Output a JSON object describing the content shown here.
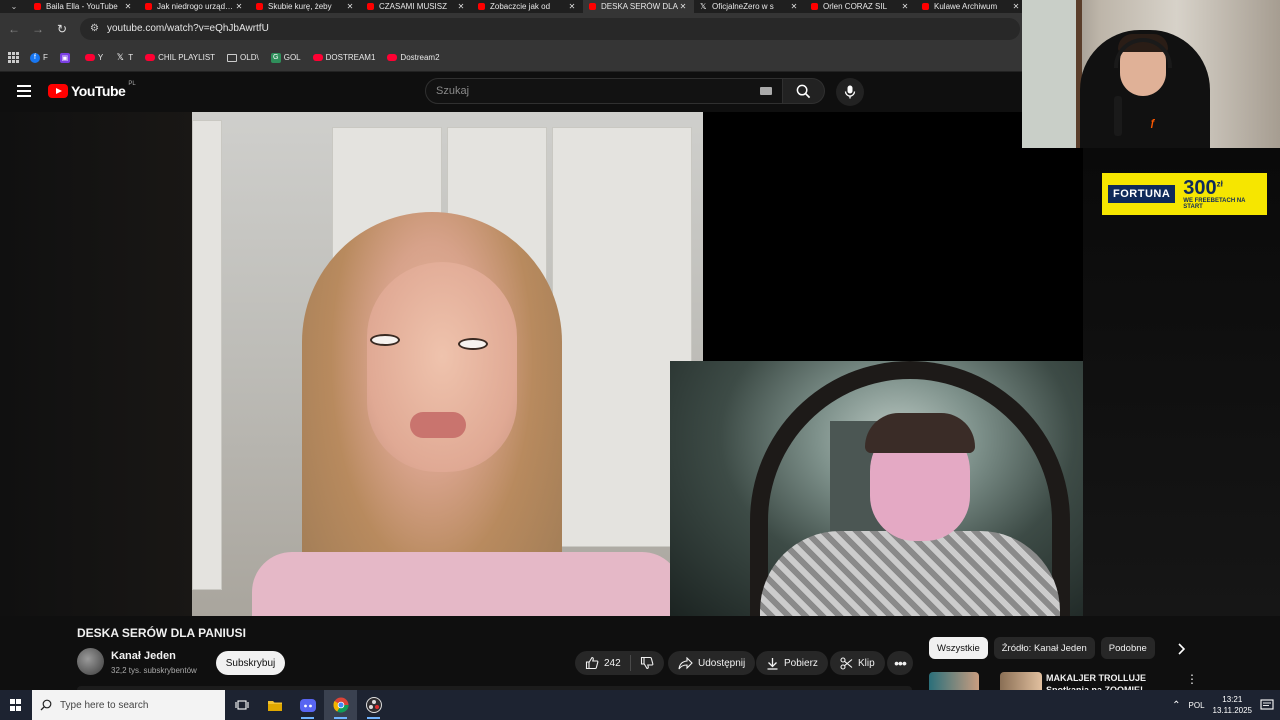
{
  "browser": {
    "tabs": [
      {
        "label": "Baila Ella - YouTube",
        "favicon": "youtube-icon",
        "active": false
      },
      {
        "label": "Jak niedrogo urządzić",
        "favicon": "youtube-icon",
        "active": false
      },
      {
        "label": "Skubie kurę, żeby",
        "favicon": "youtube-icon",
        "active": false
      },
      {
        "label": "CZASAMI MUSISZ",
        "favicon": "youtube-icon",
        "active": false
      },
      {
        "label": "Zobaczcie jak od",
        "favicon": "youtube-icon",
        "active": false
      },
      {
        "label": "DESKA SERÓW DLA",
        "favicon": "youtube-icon",
        "active": true
      },
      {
        "label": "OficjalneZero w s",
        "favicon": "x-icon",
        "active": false
      },
      {
        "label": "Orlen CORAZ SIL",
        "favicon": "youtube-icon",
        "active": false
      },
      {
        "label": "Kulawe Archiwum",
        "favicon": "youtube-icon",
        "active": false
      }
    ],
    "url": "youtube.com/watch?v=eQhJbAwrtfU",
    "bookmarks": [
      {
        "label": "F",
        "icon": "facebook-icon"
      },
      {
        "label": "",
        "icon": "twitch-icon"
      },
      {
        "label": "Y",
        "icon": "youtube-icon"
      },
      {
        "label": "T",
        "icon": "x-icon"
      },
      {
        "label": "CHIL PLAYLIST",
        "icon": "youtube-icon"
      },
      {
        "label": "OLD\\",
        "icon": "folder-icon"
      },
      {
        "label": "GOL",
        "icon": "g-icon"
      },
      {
        "label": "DOSTREAM1",
        "icon": "youtube-icon"
      },
      {
        "label": "Dostream2",
        "icon": "youtube-icon"
      }
    ]
  },
  "youtube": {
    "logo_text": "YouTube",
    "region": "PL",
    "search_placeholder": "Szukaj"
  },
  "ad": {
    "brand": "FORTUNA",
    "amount": "300",
    "currency": "zł",
    "tagline": "WE FREEBETACH NA START"
  },
  "video": {
    "title": "DESKA SERÓW DLA PANIUSI",
    "channel_name": "Kanał Jeden",
    "subscribers": "32,2 tys. subskrybentów",
    "subscribe_label": "Subskrybuj",
    "likes": "242",
    "share_label": "Udostępnij",
    "download_label": "Pobierz",
    "clip_label": "Klip"
  },
  "chips": [
    "Wszystkie",
    "Źródło: Kanał Jeden",
    "Podobne"
  ],
  "recommendation": {
    "title": "MAKALJER TROLLUJE Spotkania na ZOOMIE!"
  },
  "taskbar": {
    "search_placeholder": "Type here to search",
    "language": "POL",
    "time": "13:21",
    "date": "13.11.2025"
  },
  "colors": {
    "yt_red": "#ff0000",
    "ad_yellow": "#f6e600",
    "ad_navy": "#0f2a5a"
  }
}
